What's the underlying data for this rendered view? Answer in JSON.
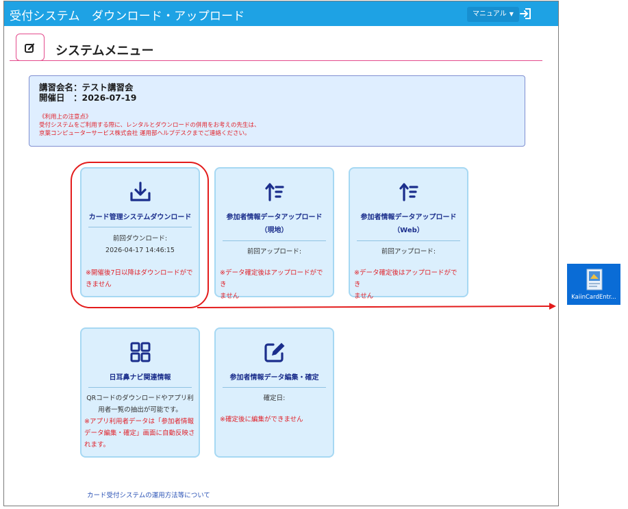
{
  "app": {
    "title": "受付システム　ダウンロード・アップロード",
    "manual_label": "マニュアル",
    "manual_caret": "▼"
  },
  "header": {
    "menu_title": "システムメニュー"
  },
  "info": {
    "lecture_name": "講習会名：テスト講習会",
    "date": "開催日　：2026-07-19",
    "notice_title": "《利用上の注意点》",
    "notice_line1": "受付システムをご利用する際に、レンタルとダウンロードの併用をお考えの先生は、",
    "notice_line2": "京葉コンピューターサービス株式会社 運用部ヘルプデスクまでご連絡ください。"
  },
  "cards": {
    "download": {
      "title": "カード管理システムダウンロード",
      "last_label": "前回ダウンロード:",
      "last_value": "2026-04-17 14:46:15",
      "warn1": "※開催後7日以降はダウンロードがで",
      "warn2": "きません"
    },
    "upload_local": {
      "title1": "参加者情報データアップロード",
      "title2": "（現地）",
      "last_label": "前回アップロード:",
      "warn1": "※データ確定後はアップロードができ",
      "warn2": "ません"
    },
    "upload_web": {
      "title1": "参加者情報データアップロード",
      "title2": "（Web）",
      "last_label": "前回アップロード:",
      "warn1": "※データ確定後はアップロードができ",
      "warn2": "ません"
    },
    "navi": {
      "title": "日耳鼻ナビ関連情報",
      "desc1": "QRコードのダウンロードやアプリ利",
      "desc2": "用者一覧の抽出が可能です。",
      "red1": "※アプリ利用者データは「参加者情報",
      "red2": "データ編集・確定」画面に自動反映さ",
      "red3": "れます。"
    },
    "edit": {
      "title": "参加者情報データ編集・確定",
      "meta": "確定日:",
      "warn": "※確定後に編集ができません"
    }
  },
  "footer": {
    "link": "カード受付システムの運用方法等について"
  },
  "desktop": {
    "file_label": "KaiinCardEntr..."
  },
  "colors": {
    "topbar": "#1ea2e4",
    "accent_pink": "#e44a8c",
    "card_bg": "#dbeffd",
    "card_title": "#1b2e8c",
    "warn_red": "#e0222a",
    "annotation_red": "#e31b1b"
  }
}
